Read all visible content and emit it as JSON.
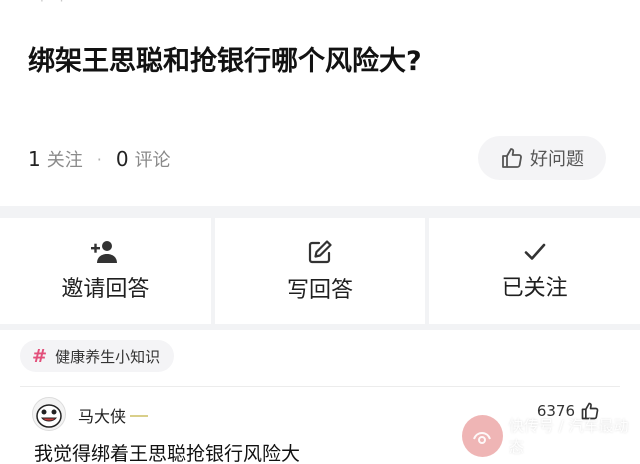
{
  "question": {
    "title": "绑架王思聪和抢银行哪个风险大?",
    "follow_count": "1",
    "follow_label": "关注",
    "separator": "·",
    "comment_count": "0",
    "comment_label": "评论",
    "good_question_label": "好问题"
  },
  "actions": [
    {
      "label": "邀请回答",
      "icon": "add-person-icon"
    },
    {
      "label": "写回答",
      "icon": "edit-icon"
    },
    {
      "label": "已关注",
      "icon": "check-icon"
    }
  ],
  "topic_tag": {
    "hash": "#",
    "label": "健康养生小知识"
  },
  "answer": {
    "author": "马大侠",
    "likes": "6376",
    "text": "我觉得绑着王思聪抢银行风险大"
  },
  "watermark": {
    "text": "快传号 / 汽车最动态"
  },
  "colors": {
    "background": "#f2f3f5",
    "card": "#ffffff",
    "tag_hash": "#e24f7a",
    "muted_text": "#8a8a8a"
  }
}
